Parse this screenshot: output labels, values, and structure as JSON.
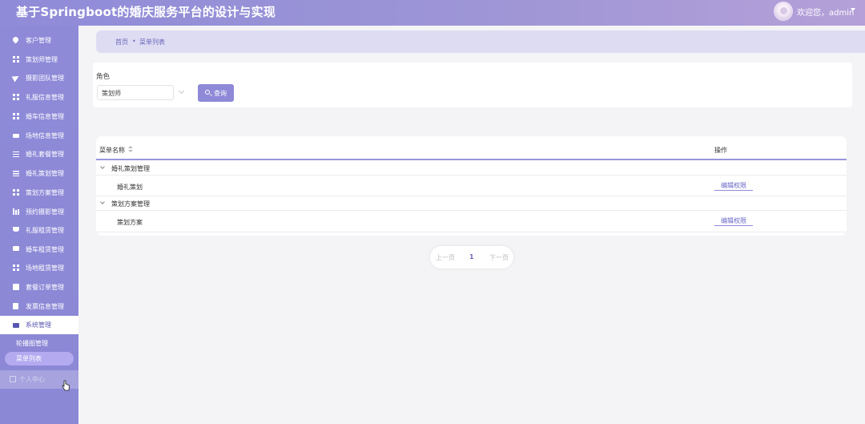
{
  "app": {
    "title": "基于Springboot的婚庆服务平台的设计与实现",
    "welcome": "欢迎您，admin"
  },
  "sidebar": {
    "items": [
      {
        "label": "客户管理",
        "icon": "pin-icon"
      },
      {
        "label": "策划师管理",
        "icon": "grid-icon"
      },
      {
        "label": "摄影团队管理",
        "icon": "send-icon"
      },
      {
        "label": "礼服信息管理",
        "icon": "grid-icon"
      },
      {
        "label": "婚车信息管理",
        "icon": "grid-icon"
      },
      {
        "label": "场地信息管理",
        "icon": "ticket-icon"
      },
      {
        "label": "婚礼套餐管理",
        "icon": "sliders-icon"
      },
      {
        "label": "婚礼策划管理",
        "icon": "list-icon"
      },
      {
        "label": "策划方案管理",
        "icon": "grid-icon"
      },
      {
        "label": "预约摄影管理",
        "icon": "bar-chart-icon"
      },
      {
        "label": "礼服租赁管理",
        "icon": "trophy-icon"
      },
      {
        "label": "婚车租赁管理",
        "icon": "chat-icon"
      },
      {
        "label": "场地租赁管理",
        "icon": "grid-icon"
      },
      {
        "label": "套餐订单管理",
        "icon": "box-icon"
      },
      {
        "label": "发票信息管理",
        "icon": "clipboard-icon"
      },
      {
        "label": "系统管理",
        "icon": "shop-icon"
      }
    ],
    "sub_items": [
      {
        "label": "轮播图管理"
      },
      {
        "label": "菜单列表"
      }
    ],
    "personal": {
      "label": "个人中心",
      "icon": "user-icon"
    }
  },
  "breadcrumb": {
    "home": "首页",
    "separator": "•",
    "current": "菜单列表"
  },
  "search": {
    "role_label": "角色",
    "role_value": "策划师",
    "button_label": "查询"
  },
  "table": {
    "headers": {
      "name": "菜单名称",
      "action": "操作"
    },
    "rows": [
      {
        "name": "婚礼策划管理",
        "level": 0,
        "action": ""
      },
      {
        "name": "婚礼策划",
        "level": 1,
        "action": "编辑权限"
      },
      {
        "name": "策划方案管理",
        "level": 0,
        "action": ""
      },
      {
        "name": "策划方案",
        "level": 1,
        "action": "编辑权限"
      }
    ]
  },
  "pagination": {
    "prev": "上一页",
    "page": "1",
    "next": "下一页"
  },
  "colors": {
    "accent": "#8e8ad8",
    "header_start": "#8f8bd8",
    "header_end": "#b5a0d8"
  }
}
